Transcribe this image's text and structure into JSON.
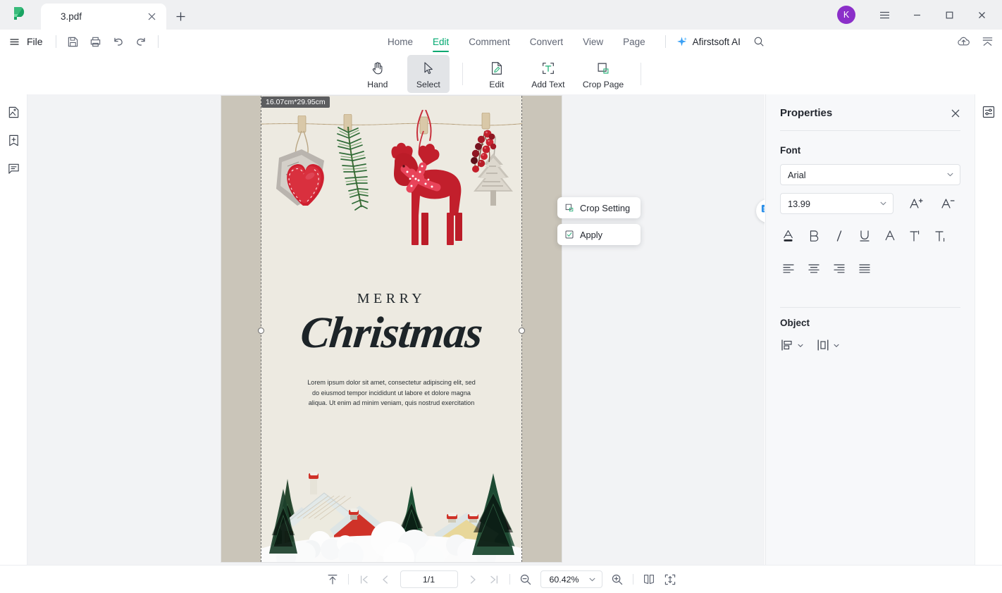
{
  "window": {
    "app_logo": "afirstsoft-logo",
    "tab_title": "3.pdf",
    "tab_close": "×",
    "new_tab": "+",
    "avatar_initial": "K",
    "menu_icon": "hamburger-icon",
    "minimize": "−",
    "maximize": "□",
    "close": "×"
  },
  "menubar": {
    "file_label": "File",
    "quick_icons": [
      "save-icon",
      "print-icon",
      "undo-icon",
      "redo-icon"
    ],
    "tabs": [
      {
        "label": "Home",
        "active": false
      },
      {
        "label": "Edit",
        "active": true
      },
      {
        "label": "Comment",
        "active": false
      },
      {
        "label": "Convert",
        "active": false
      },
      {
        "label": "View",
        "active": false
      },
      {
        "label": "Page",
        "active": false
      }
    ],
    "ai_label": "Afirstsoft AI",
    "search_icon": "search-icon",
    "right_icons": [
      "cloud-upload-icon",
      "collapse-ribbon-icon"
    ]
  },
  "ribbon": {
    "tools": [
      {
        "label": "Hand",
        "icon": "hand-icon",
        "selected": false
      },
      {
        "label": "Select",
        "icon": "cursor-arrow-icon",
        "selected": true
      },
      {
        "label": "Edit",
        "icon": "edit-document-icon",
        "selected": false
      },
      {
        "label": "Add Text",
        "icon": "add-text-icon",
        "selected": false
      },
      {
        "label": "Crop Page",
        "icon": "crop-page-icon",
        "selected": false
      }
    ]
  },
  "left_rail": {
    "items": [
      {
        "icon": "thumbnail-panel-icon"
      },
      {
        "icon": "bookmark-add-icon"
      },
      {
        "icon": "comment-panel-icon"
      }
    ]
  },
  "right_rail": {
    "items": [
      {
        "icon": "properties-panel-icon"
      }
    ]
  },
  "document": {
    "crop_dimensions": "16.07cm*29.95cm",
    "title_small": "MERRY",
    "title_large": "Christmas",
    "body_text": "Lorem ipsum dolor sit amet, consectetur adipiscing elit, sed do eiusmod tempor incididunt ut labore et dolore magna aliqua. Ut enim ad minim veniam, quis nostrud exercitation",
    "paper_color": "#edeae1",
    "mat_color": "#cac5b9"
  },
  "crop_menu": {
    "items": [
      {
        "label": "Crop Setting",
        "icon": "crop-setting-icon"
      },
      {
        "label": "Apply",
        "icon": "apply-check-icon"
      }
    ]
  },
  "convert_badge": {
    "icon": "pdf-to-word-icon"
  },
  "properties": {
    "title": "Properties",
    "close_icon": "close-icon",
    "font_section": {
      "title": "Font",
      "family_value": "Arial",
      "size_value": "13.99",
      "increase_icon": "increase-font-size-icon",
      "decrease_icon": "decrease-font-size-icon",
      "style_buttons": [
        {
          "icon": "font-color-icon",
          "name": "font-color"
        },
        {
          "icon": "bold-icon",
          "name": "bold"
        },
        {
          "icon": "italic-icon",
          "name": "italic"
        },
        {
          "icon": "underline-icon",
          "name": "underline"
        },
        {
          "icon": "strikethrough-icon",
          "name": "strikethrough"
        },
        {
          "icon": "superscript-icon",
          "name": "superscript"
        },
        {
          "icon": "subscript-icon",
          "name": "subscript"
        }
      ],
      "align_buttons": [
        {
          "icon": "align-left-icon",
          "name": "align-left"
        },
        {
          "icon": "align-center-icon",
          "name": "align-center"
        },
        {
          "icon": "align-right-icon",
          "name": "align-right"
        },
        {
          "icon": "align-justify-icon",
          "name": "align-justify"
        }
      ]
    },
    "object_section": {
      "title": "Object",
      "buttons": [
        {
          "icon": "align-objects-icon",
          "name": "align-objects"
        },
        {
          "icon": "distribute-objects-icon",
          "name": "distribute-objects"
        }
      ]
    }
  },
  "status_bar": {
    "scroll_top_icon": "scroll-to-top-icon",
    "first_page_icon": "first-page-icon",
    "prev_page_icon": "prev-page-icon",
    "page_value": "1/1",
    "next_page_icon": "next-page-icon",
    "last_page_icon": "last-page-icon",
    "zoom_out_icon": "zoom-out-icon",
    "zoom_value": "60.42%",
    "zoom_in_icon": "zoom-in-icon",
    "dual_page_icon": "dual-page-view-icon",
    "fit_height_icon": "fit-height-icon"
  },
  "colors": {
    "accent": "#00a870",
    "avatar": "#8b2fc9",
    "canvas": "#f2f3f5"
  }
}
